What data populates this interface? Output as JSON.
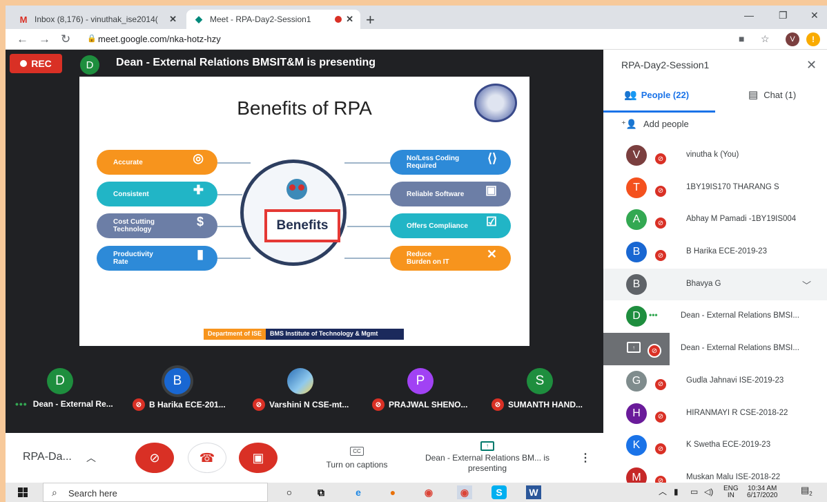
{
  "browser": {
    "tabs": [
      {
        "title": "Inbox (8,176) - vinuthak_ise2014(",
        "favicon": "gmail-icon"
      },
      {
        "title": "Meet - RPA-Day2-Session1",
        "favicon": "meet-icon"
      }
    ],
    "url": "meet.google.com/nka-hotz-hzy",
    "profile_initial": "V",
    "warning_glyph": "!"
  },
  "meeting": {
    "rec_label": "REC",
    "presenter_initial": "D",
    "presenting_text": "Dean - External Relations BMSIT&M is presenting",
    "name": "RPA-Da...",
    "captions_label": "Turn on captions",
    "cc": "CC",
    "presenting_control": "Dean - External Relations BM... is presenting"
  },
  "slide": {
    "title": "Benefits of RPA",
    "center_label": "Benefits",
    "left": [
      "Accurate",
      "Consistent",
      "Cost Cutting Technology",
      "Productivity Rate"
    ],
    "right": [
      "No/Less Coding Required",
      "Reliable Software",
      "Offers Compliance",
      "Reduce Burden on IT"
    ],
    "footer_dept": "Department of ISE",
    "footer_inst": "BMS Institute of Technology & Mgmt"
  },
  "thumbnails": [
    {
      "initial": "D",
      "name": "Dean - External Re...",
      "color": "#1e8e3e"
    },
    {
      "initial": "B",
      "name": "B Harika ECE-201...",
      "color": "#1967d2"
    },
    {
      "initial": "",
      "name": "Varshini N CSE-mt...",
      "color": "#4a90c8"
    },
    {
      "initial": "P",
      "name": "PRAJWAL SHENO...",
      "color": "#a142f4"
    },
    {
      "initial": "S",
      "name": "SUMANTH HAND...",
      "color": "#1e8e3e"
    }
  ],
  "sidebar": {
    "title": "RPA-Day2-Session1",
    "people_tab": "People (22)",
    "chat_tab": "Chat (1)",
    "add_people": "Add people",
    "people": [
      {
        "initial": "V",
        "name": "vinutha k (You)",
        "color": "#7b3f3f"
      },
      {
        "initial": "T",
        "name": "1BY19IS170 THARANG S",
        "color": "#f4511e"
      },
      {
        "initial": "A",
        "name": "Abhay M Pamadi -1BY19IS004",
        "color": "#33a852"
      },
      {
        "initial": "B",
        "name": "B Harika ECE-2019-23",
        "color": "#1967d2"
      },
      {
        "initial": "B",
        "name": "Bhavya G",
        "color": "#5f6368"
      },
      {
        "initial": "D",
        "name": "Dean - External Relations BMSI...",
        "color": "#1e8e3e"
      },
      {
        "initial": "",
        "name": "Dean - External Relations BMSI...",
        "color": "#6c6f73"
      },
      {
        "initial": "G",
        "name": "Gudla Jahnavi ISE-2019-23",
        "color": "#7f8c8d"
      },
      {
        "initial": "H",
        "name": "HIRANMAYI R CSE-2018-22",
        "color": "#6a1b9a"
      },
      {
        "initial": "K",
        "name": "K Swetha ECE-2019-23",
        "color": "#1a73e8"
      },
      {
        "initial": "M",
        "name": "Muskan Malu ISE-2018-22",
        "color": "#c62828"
      }
    ]
  },
  "taskbar": {
    "search_placeholder": "Search here",
    "lang": "ENG",
    "lang2": "IN",
    "time": "10:34 AM",
    "date": "6/17/2020",
    "notif_count": "2"
  }
}
